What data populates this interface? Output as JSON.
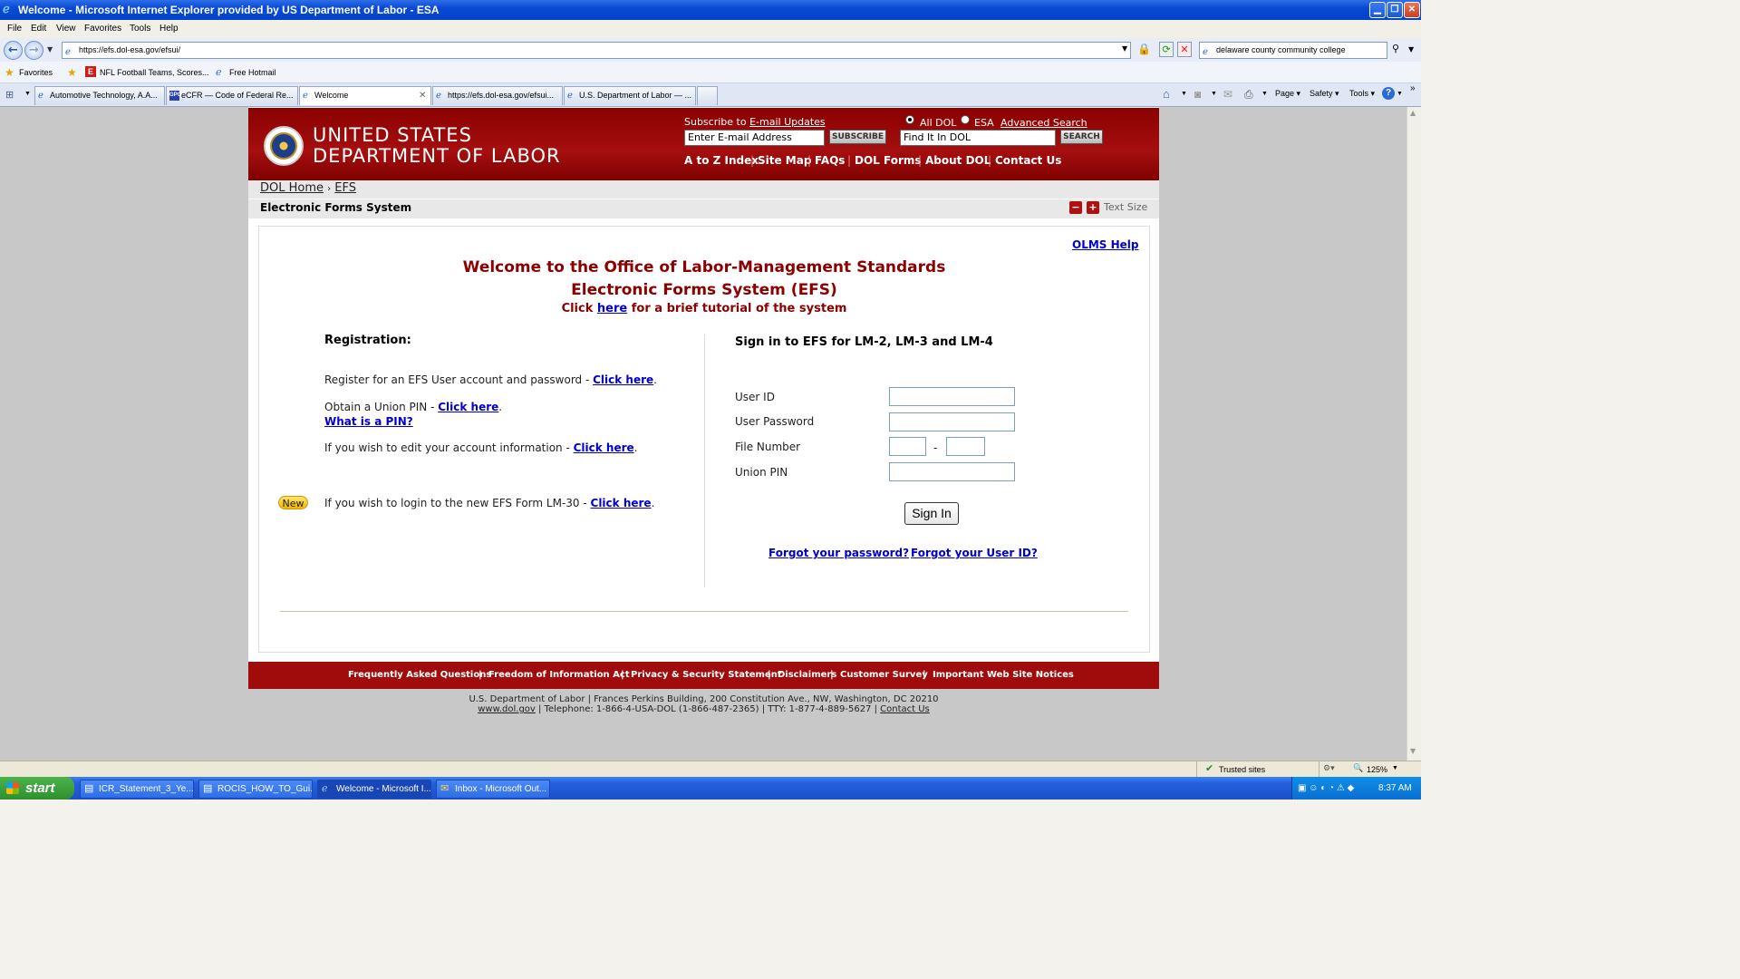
{
  "window": {
    "title": "Welcome - Microsoft Internet Explorer provided by US Department of Labor - ESA",
    "minimize": "▁",
    "restore": "❐",
    "close": "✕"
  },
  "menu": [
    "File",
    "Edit",
    "View",
    "Favorites",
    "Tools",
    "Help"
  ],
  "address": {
    "url": "https://efs.dol-esa.gov/efsui/",
    "search_value": "delaware county community college"
  },
  "favorites_bar": {
    "favorites_label": "Favorites",
    "items": [
      "NFL Football Teams, Scores...",
      "Free Hotmail"
    ]
  },
  "tabs": [
    {
      "label": "Automotive Technology, A.A..."
    },
    {
      "label": "eCFR — Code of Federal Re..."
    },
    {
      "label": "Welcome"
    },
    {
      "label": "https://efs.dol-esa.gov/efsui..."
    },
    {
      "label": "U.S. Department of Labor — ..."
    }
  ],
  "command_bar": [
    "Page",
    "Safety",
    "Tools"
  ],
  "header": {
    "org_line1": "UNITED STATES",
    "org_line2": "DEPARTMENT OF LABOR",
    "subscribe_prefix": "Subscribe to ",
    "subscribe_link": "E-mail Updates",
    "email_placeholder": "Enter E-mail Address",
    "subscribe_button": "SUBSCRIBE",
    "radio_all": "All DOL",
    "radio_esa": "ESA",
    "advanced_search": "Advanced Search",
    "search_placeholder": "Find It In DOL",
    "search_button": "SEARCH",
    "nav": [
      "A to Z Index",
      "Site Map",
      "FAQs",
      "DOL Forms",
      "About DOL",
      "Contact Us"
    ]
  },
  "breadcrumb": {
    "home": "DOL Home",
    "sep": "›",
    "current": "EFS"
  },
  "page_title": "Electronic Forms System",
  "text_size_label": "Text Size",
  "main": {
    "help_link": "OLMS Help",
    "welcome_line1": "Welcome to the Office of Labor-Management Standards",
    "welcome_line2": "Electronic Forms System (EFS)",
    "tutorial_prefix": "Click ",
    "tutorial_link": "here",
    "tutorial_suffix": " for a brief tutorial of the system",
    "registration_heading": "Registration:",
    "reg_account_text": "Register for an EFS User account and password - ",
    "reg_pin_text": "Obtain a Union PIN - ",
    "what_is_pin": "What is a PIN?",
    "edit_account_text": "If you wish to edit your account information - ",
    "new_badge": "New",
    "lm30_text": "If you wish to login to the new EFS Form LM-30 - ",
    "click_here": "Click here",
    "period": ".",
    "signin_heading": "Sign in to EFS for LM-2, LM-3 and LM-4",
    "user_id_label": "User ID",
    "password_label": "User Password",
    "file_number_label": "File Number",
    "file_number_sep": "-",
    "union_pin_label": "Union PIN",
    "signin_button": "Sign In",
    "forgot_password": "Forgot your password?",
    "forgot_userid": "Forgot your User ID?"
  },
  "footer": {
    "links": [
      "Frequently Asked Questions",
      "Freedom of Information Act",
      "Privacy & Security Statement",
      "Disclaimers",
      "Customer Survey",
      "Important Web Site Notices"
    ],
    "sep": "|",
    "address_line1": "U.S. Department of Labor | Frances Perkins Building, 200 Constitution Ave., NW, Washington, DC 20210",
    "dol_link": "www.dol.gov",
    "phone_text": " | Telephone: 1-866-4-USA-DOL (1-866-487-2365) | TTY: 1-877-4-889-5627 | ",
    "contact_link": "Contact Us"
  },
  "status": {
    "zone": "Trusted sites",
    "zoom": "125%"
  },
  "taskbar": {
    "start": "start",
    "tasks": [
      "ICR_Statement_3_Ye...",
      "ROCIS_HOW_TO_Gui...",
      "Welcome - Microsoft I...",
      "Inbox - Microsoft Out..."
    ],
    "clock": "8:37 AM"
  },
  "colors": {
    "dol_red": "#a00c0c",
    "link_blue": "#0000cc",
    "heading_red": "#8b0000"
  }
}
